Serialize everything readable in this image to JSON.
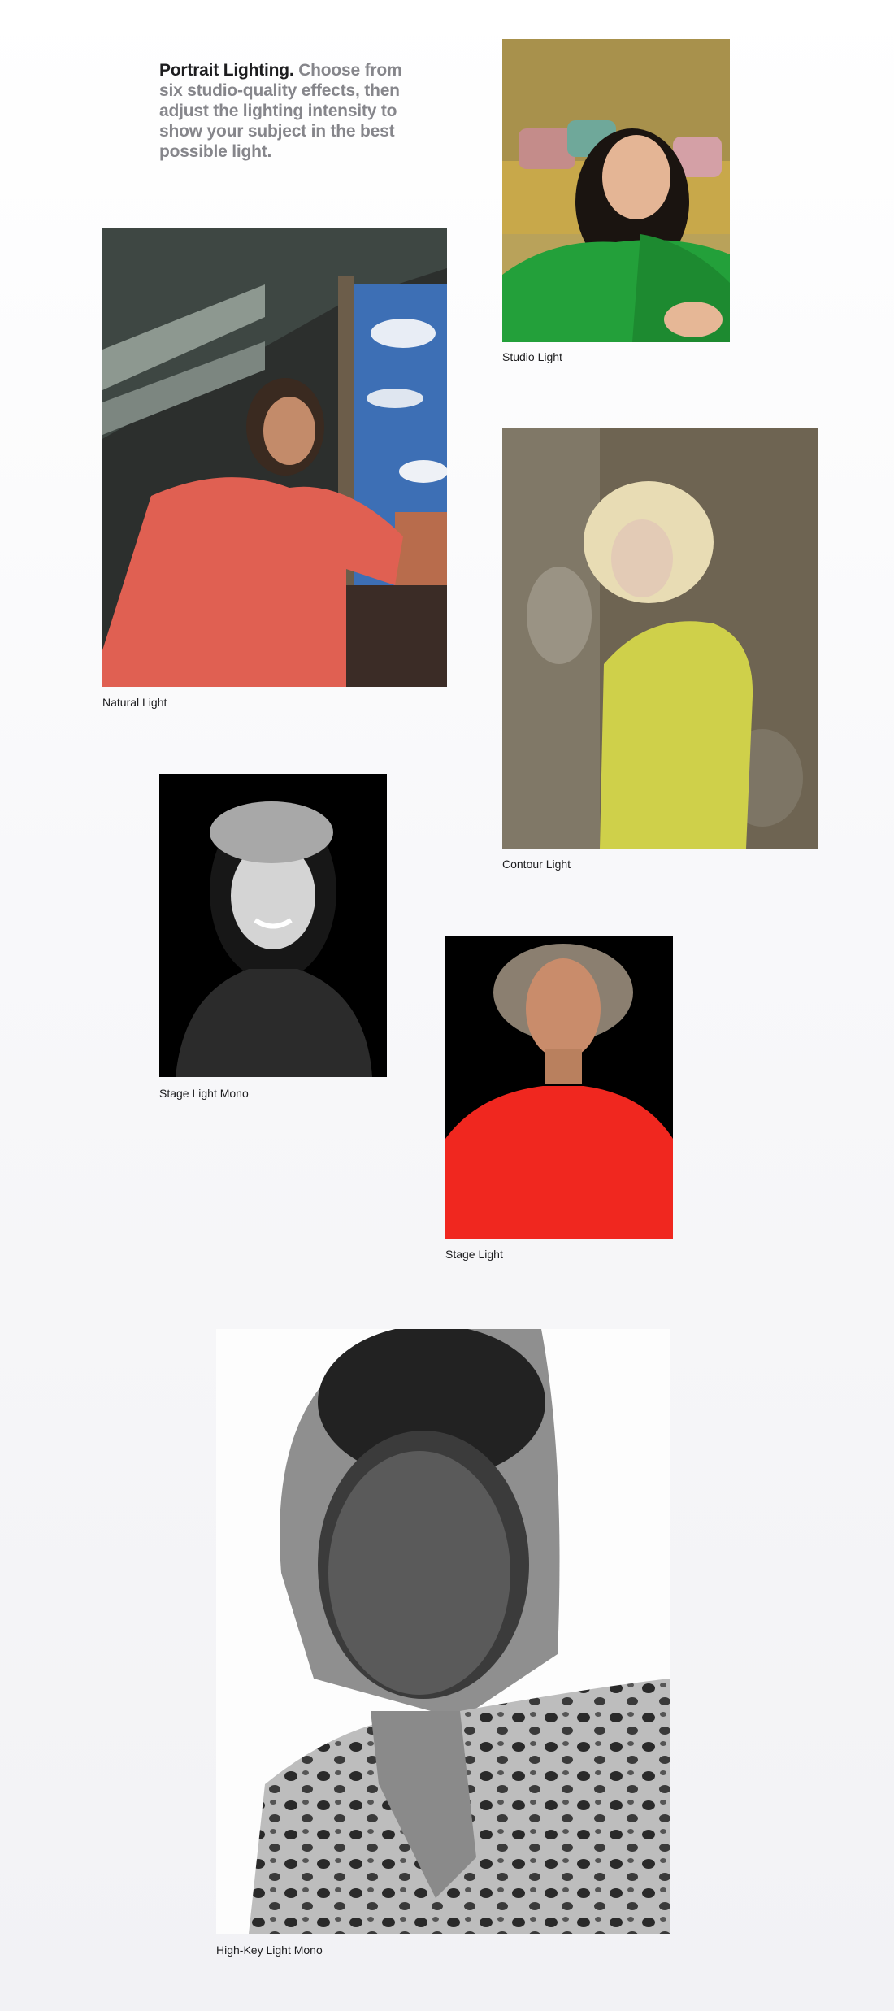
{
  "intro": {
    "lead": "Portrait Lighting.",
    "rest": " Choose from six studio-quality effects, then adjust the lighting intensity to show your subject in the best possible light."
  },
  "photos": [
    {
      "caption": "Studio Light",
      "icon": "studio-light-photo"
    },
    {
      "caption": "Natural Light",
      "icon": "natural-light-photo"
    },
    {
      "caption": "Contour Light",
      "icon": "contour-light-photo"
    },
    {
      "caption": "Stage Light Mono",
      "icon": "stage-light-mono-photo"
    },
    {
      "caption": "Stage Light",
      "icon": "stage-light-photo"
    },
    {
      "caption": "High-Key Light Mono",
      "icon": "high-key-light-mono-photo"
    }
  ],
  "colors": {
    "text_primary": "#1d1d1f",
    "text_secondary": "#86868b",
    "background": "#f5f5f7"
  }
}
